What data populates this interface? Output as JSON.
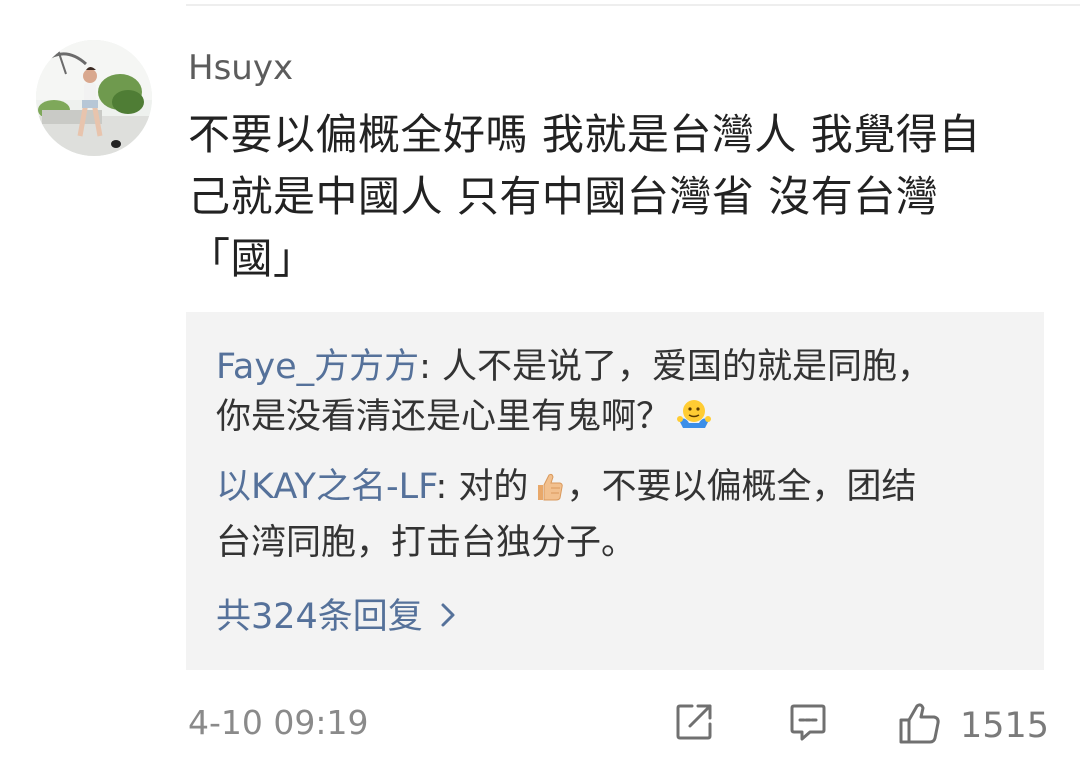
{
  "comment": {
    "username": "Hsuyx",
    "lines": [
      "不要以偏概全好嗎 我就是台灣人 我覺得自",
      "己就是中國人 只有中國台灣省 沒有台灣",
      "「國」"
    ],
    "timestamp": "4-10 09:19",
    "like_count": "1515"
  },
  "replies": [
    {
      "user": "Faye_方方方",
      "separator": ": ",
      "text_line1": "人不是说了，爱国的就是同胞，",
      "text_line2": "你是没看清还是心里有鬼啊？",
      "emoji": "shrug-emoji-icon"
    },
    {
      "user": "以KAY之名-LF",
      "separator": ": ",
      "text_before_emoji": "对的",
      "emoji": "thumbs-up-emoji-icon",
      "text_after_emoji": "，不要以偏概全，团结",
      "text_line2": "台湾同胞，打击台独分子。"
    }
  ],
  "more_replies_label": "共324条回复",
  "icons": {
    "forward": "share-icon",
    "comment": "comment-icon",
    "like": "thumbs-up-icon"
  },
  "colors": {
    "link_blue": "#55719a",
    "reply_bg": "#f3f3f3",
    "text_dark": "#222222",
    "meta_gray": "#8a8a8a"
  }
}
